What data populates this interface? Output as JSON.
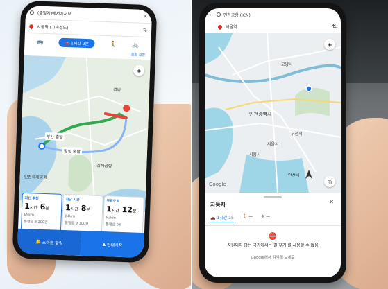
{
  "left_phone": {
    "origin": "(출발지)에서에서요",
    "destination": "서울역 (고속철도)",
    "mode_chip": "1시간 9분",
    "options_link": "옵션 설정",
    "map_labels": [
      "부산 출발",
      "장성 출발",
      "김해공항",
      "경남",
      "인천국제공항"
    ],
    "route_cards": [
      {
        "tag": "최신 추천",
        "time_h": "1",
        "time_m": "6",
        "distance": "89km",
        "toll": "통행료 8,200원"
      },
      {
        "tag": "최단 시간",
        "time_h": "1",
        "time_m": "8",
        "distance": "84km",
        "toll": "통행료 9,300원"
      },
      {
        "tag": "무료도로",
        "time_h": "1",
        "time_m": "12",
        "distance": "92km",
        "toll": "통행료 0원"
      }
    ],
    "unit_hour": "시간",
    "unit_min": "분",
    "bottom_left_button": "스마트 알림",
    "bottom_right_button": "안내시작",
    "colors": {
      "primary": "#1a73e8",
      "route": "#34a853",
      "traffic": "#ea4335"
    }
  },
  "right_phone": {
    "origin": "인천공항 (ICN)",
    "destination": "서울역",
    "map_labels": [
      "인천광역시",
      "고양시",
      "서울시",
      "부천시",
      "시흥시",
      "안산시"
    ],
    "google_logo": "Google",
    "sheet_title": "자동차",
    "tabs": [
      "1시간 15",
      "—",
      "—"
    ],
    "message": "지원되지 않는 국가에서는 길 찾기 를 사용할 수 없음",
    "message_link": "Google에서 검색해 보세요",
    "colors": {
      "water": "#9ed6e8",
      "land": "#e9ecef",
      "road": "#ffffff"
    }
  }
}
